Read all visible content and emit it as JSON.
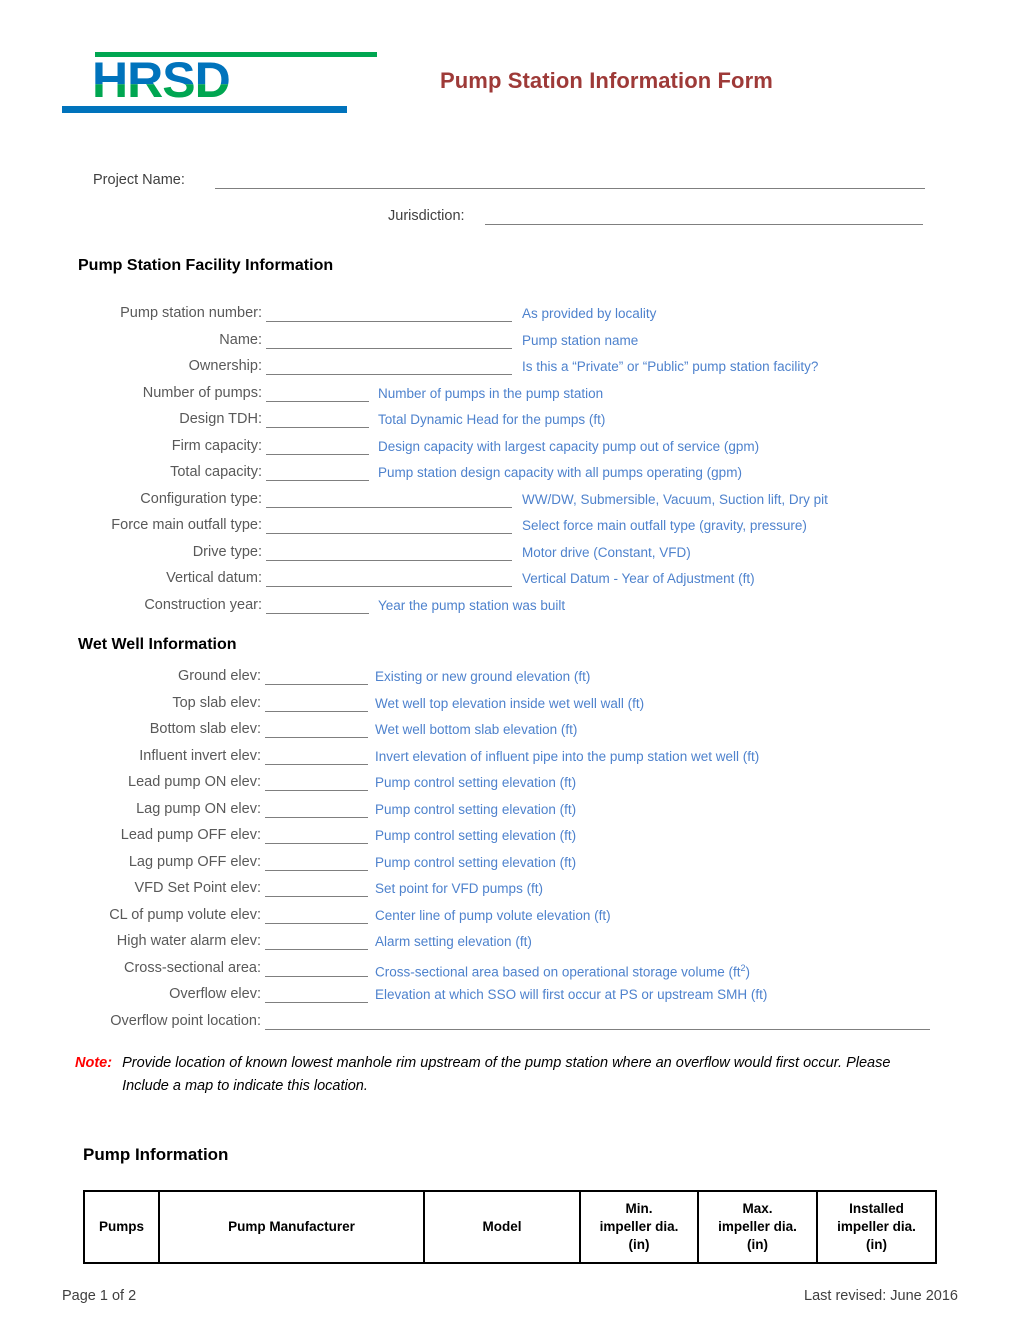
{
  "header": {
    "logo_text": "HRSD",
    "logo_green": "#00a651",
    "logo_blue": "#0073bc",
    "title": "Pump Station Information Form",
    "title_color": "#9e3a38"
  },
  "top_fields": [
    {
      "label": "Project Name:"
    },
    {
      "label": "Jurisdiction:"
    }
  ],
  "facility_section": {
    "heading": "Pump Station Facility Information",
    "rows": [
      {
        "label": "Pump station number:",
        "hint": "As provided by locality",
        "blank": "long"
      },
      {
        "label": "Name:",
        "hint": "Pump station name",
        "blank": "long"
      },
      {
        "label": "Ownership:",
        "hint": "Is this a “Private” or “Public” pump station facility?",
        "blank": "long"
      },
      {
        "label": "Number of pumps:",
        "hint": "Number of pumps in the pump station",
        "blank": "short"
      },
      {
        "label": "Design TDH:",
        "hint": "Total Dynamic Head for the pumps (ft)",
        "blank": "short"
      },
      {
        "label": "Firm capacity:",
        "hint": "Design capacity with largest capacity pump out of service (gpm)",
        "blank": "short"
      },
      {
        "label": "Total capacity:",
        "hint": "Pump station design capacity with all pumps operating (gpm)",
        "blank": "short"
      },
      {
        "label": "Configuration type:",
        "hint": "WW/DW, Submersible, Vacuum, Suction lift, Dry pit",
        "blank": "long"
      },
      {
        "label": "Force main outfall type:",
        "hint": "Select force main outfall type (gravity, pressure)",
        "blank": "long"
      },
      {
        "label": "Drive type:",
        "hint": "Motor drive (Constant, VFD)",
        "blank": "long"
      },
      {
        "label": "Vertical datum:",
        "hint": "Vertical Datum - Year of Adjustment (ft)",
        "blank": "long"
      },
      {
        "label": "Construction year:",
        "hint": "Year the pump station was built",
        "blank": "short"
      }
    ]
  },
  "wetwell_section": {
    "heading": "Wet Well Information",
    "rows": [
      {
        "label": "Ground elev:",
        "hint": "Existing or new ground elevation (ft)",
        "blank": "short"
      },
      {
        "label": "Top slab elev:",
        "hint": "Wet well top elevation inside wet well wall (ft)",
        "blank": "short"
      },
      {
        "label": "Bottom slab elev:",
        "hint": "Wet well bottom slab elevation (ft)",
        "blank": "short"
      },
      {
        "label": "Influent invert elev:",
        "hint": "Invert elevation of influent pipe into the pump station wet well (ft)",
        "blank": "short"
      },
      {
        "label": "Lead pump ON elev:",
        "hint": "Pump control setting elevation (ft)",
        "blank": "short"
      },
      {
        "label": "Lag pump ON elev:",
        "hint": "Pump control setting elevation (ft)",
        "blank": "short"
      },
      {
        "label": "Lead pump OFF elev:",
        "hint": "Pump control setting elevation (ft)",
        "blank": "short"
      },
      {
        "label": "Lag pump OFF elev:",
        "hint": "Pump control setting elevation (ft)",
        "blank": "short"
      },
      {
        "label": "VFD Set Point elev:",
        "hint": "Set point for VFD pumps (ft)",
        "blank": "short"
      },
      {
        "label": "CL of pump volute elev:",
        "hint": "Center line of pump volute elevation  (ft)",
        "blank": "short"
      },
      {
        "label": "High water alarm elev:",
        "hint": "Alarm setting elevation (ft)",
        "blank": "short"
      },
      {
        "label": "Cross-sectional area:",
        "hint": "Cross-sectional area based on operational storage volume (ft²)",
        "blank": "short"
      },
      {
        "label": "Overflow elev:",
        "hint": "Elevation at which SSO will first occur at PS or upstream SMH (ft)",
        "blank": "short"
      },
      {
        "label": "Overflow point location:",
        "hint": "",
        "blank": "full"
      }
    ]
  },
  "note": {
    "word": "Note:",
    "body": "Provide location of known lowest manhole rim upstream of the pump station where an overflow would first occur.  Please Include a map to indicate this location."
  },
  "pump_section": {
    "heading": "Pump Information",
    "columns": [
      "Pumps",
      "Pump Manufacturer",
      "Model",
      "Min. impeller dia. (in)",
      "Max. impeller dia. (in)",
      "Installed impeller dia. (in)"
    ],
    "columns_lines": [
      [
        "Pumps"
      ],
      [
        "Pump Manufacturer"
      ],
      [
        "Model"
      ],
      [
        "Min.",
        "impeller dia.",
        "(in)"
      ],
      [
        "Max.",
        "impeller dia.",
        "(in)"
      ],
      [
        "Installed",
        "impeller dia.",
        "(in)"
      ]
    ]
  },
  "footer": {
    "page": "Page 1 of 2",
    "revised": "Last revised: June 2016"
  }
}
